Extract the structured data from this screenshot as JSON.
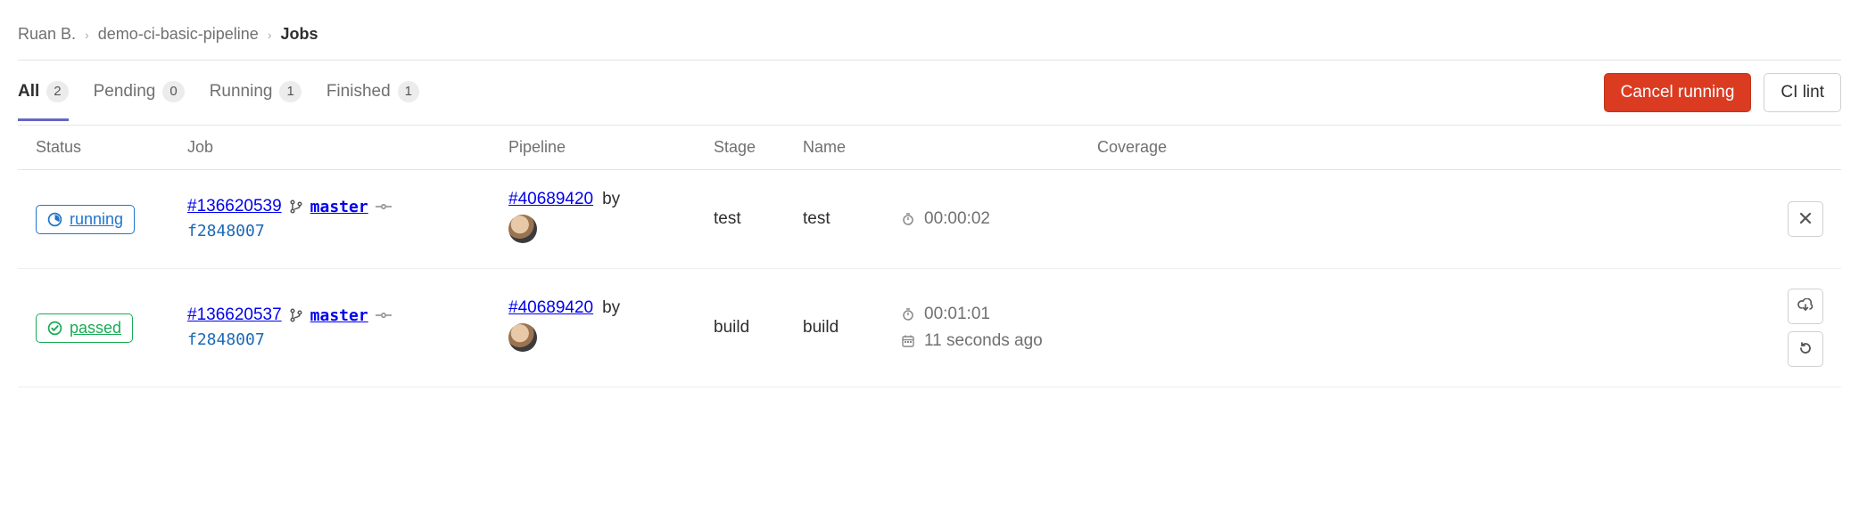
{
  "breadcrumb": {
    "owner": "Ruan B.",
    "project": "demo-ci-basic-pipeline",
    "current": "Jobs"
  },
  "tabs": {
    "all": {
      "label": "All",
      "count": "2"
    },
    "pending": {
      "label": "Pending",
      "count": "0"
    },
    "running": {
      "label": "Running",
      "count": "1"
    },
    "finished": {
      "label": "Finished",
      "count": "1"
    }
  },
  "buttons": {
    "cancel_running": "Cancel running",
    "ci_lint": "CI lint"
  },
  "columns": {
    "status": "Status",
    "job": "Job",
    "pipeline": "Pipeline",
    "stage": "Stage",
    "name": "Name",
    "coverage": "Coverage"
  },
  "rows": [
    {
      "status": {
        "kind": "running",
        "label": "running"
      },
      "job": {
        "id": "#136620539",
        "branch": "master",
        "commit": "f2848007"
      },
      "pipeline": {
        "id": "#40689420",
        "by": "by"
      },
      "stage": "test",
      "name": "test",
      "duration": "00:00:02",
      "finished_ago": "",
      "actions": [
        "cancel"
      ]
    },
    {
      "status": {
        "kind": "passed",
        "label": "passed"
      },
      "job": {
        "id": "#136620537",
        "branch": "master",
        "commit": "f2848007"
      },
      "pipeline": {
        "id": "#40689420",
        "by": "by"
      },
      "stage": "build",
      "name": "build",
      "duration": "00:01:01",
      "finished_ago": "11 seconds ago",
      "actions": [
        "download",
        "retry"
      ]
    }
  ]
}
